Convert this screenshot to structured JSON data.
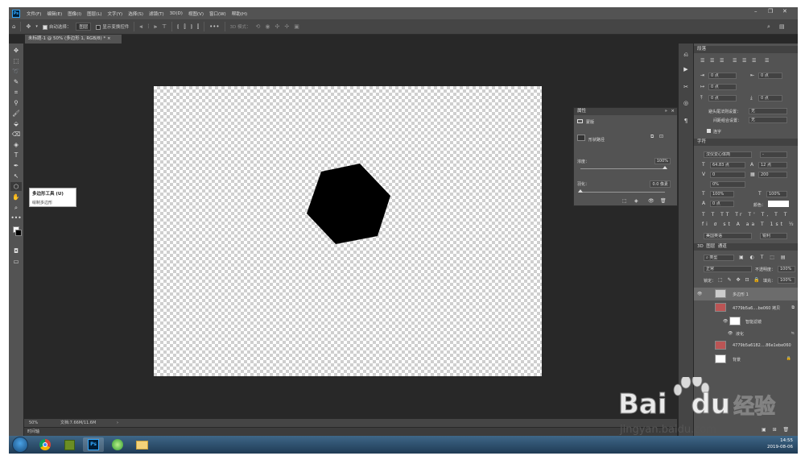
{
  "menubar": {
    "logo": "Ps",
    "items": [
      "文件(F)",
      "编辑(E)",
      "图像(I)",
      "图层(L)",
      "文字(Y)",
      "选择(S)",
      "滤镜(T)",
      "3D(D)",
      "视图(V)",
      "窗口(W)",
      "帮助(H)"
    ]
  },
  "options": {
    "auto_select": "自动选择：",
    "auto_select_value": "图层",
    "show_transform": "显示变换控件",
    "mode_3d": "3D 模式："
  },
  "document": {
    "tab_title": "未标题-1 @ 50% (多边形 1, RGB/8) *",
    "zoom": "50%",
    "doc_info": "文档:7.66M/11.6M"
  },
  "tooltip": {
    "title": "多边形工具 (U)",
    "desc": "绘制多边形"
  },
  "properties": {
    "tab": "属性",
    "mask_label": "蒙版",
    "shape_path": "形状路径",
    "density_label": "浓度：",
    "density_value": "100%",
    "density_fraction": 1.0,
    "feather_label": "羽化：",
    "feather_value": "0.0 像素",
    "feather_fraction": 0.0
  },
  "paragraph": {
    "tab": "段落",
    "indent_left": "0 点",
    "indent_right": "0 点",
    "indent_first": "0 点",
    "space_before": "0 点",
    "space_after": "0 点",
    "kinsoku_label": "避头尾法则设置：",
    "kinsoku_value": "无",
    "mojikumi_label": "间距组合设置：",
    "mojikumi_value": "无",
    "hyphenate": "连字"
  },
  "character": {
    "tab": "字符",
    "font_family": "汉仪爱心体简",
    "font_style": "-",
    "font_size": "64.83 点",
    "leading": "12 点",
    "kerning": "0",
    "tracking": "200",
    "tsume": "0%",
    "vscale": "100%",
    "hscale": "100%",
    "baseline": "0 点",
    "color_label": "颜色：",
    "language": "美国英语",
    "antialias": "锐利"
  },
  "layers_panel": {
    "tabs": [
      "3D",
      "图层",
      "通道"
    ],
    "kind_filter": "类型",
    "blend_mode": "正常",
    "opacity_label": "不透明度：",
    "opacity_value": "100%",
    "lock_label": "锁定：",
    "fill_label": "填充：",
    "fill_value": "100%",
    "layers": [
      {
        "name": "多边形 1",
        "selected": true
      },
      {
        "name": "4779b5a6....be060 拷贝",
        "selected": false
      },
      {
        "name": "智能滤镜",
        "selected": false
      },
      {
        "name": "液化",
        "selected": false
      },
      {
        "name": "4779b5a6182....86e1ebe060",
        "selected": false
      },
      {
        "name": "背景",
        "selected": false
      }
    ]
  },
  "timeline": {
    "label": "时间轴"
  },
  "taskbar": {
    "time": "14:55",
    "date": "2019-08-06"
  },
  "watermark": {
    "brand": "Bai",
    "brand2": "du",
    "cn": "经验",
    "url": "jingyan.baidu.com"
  }
}
